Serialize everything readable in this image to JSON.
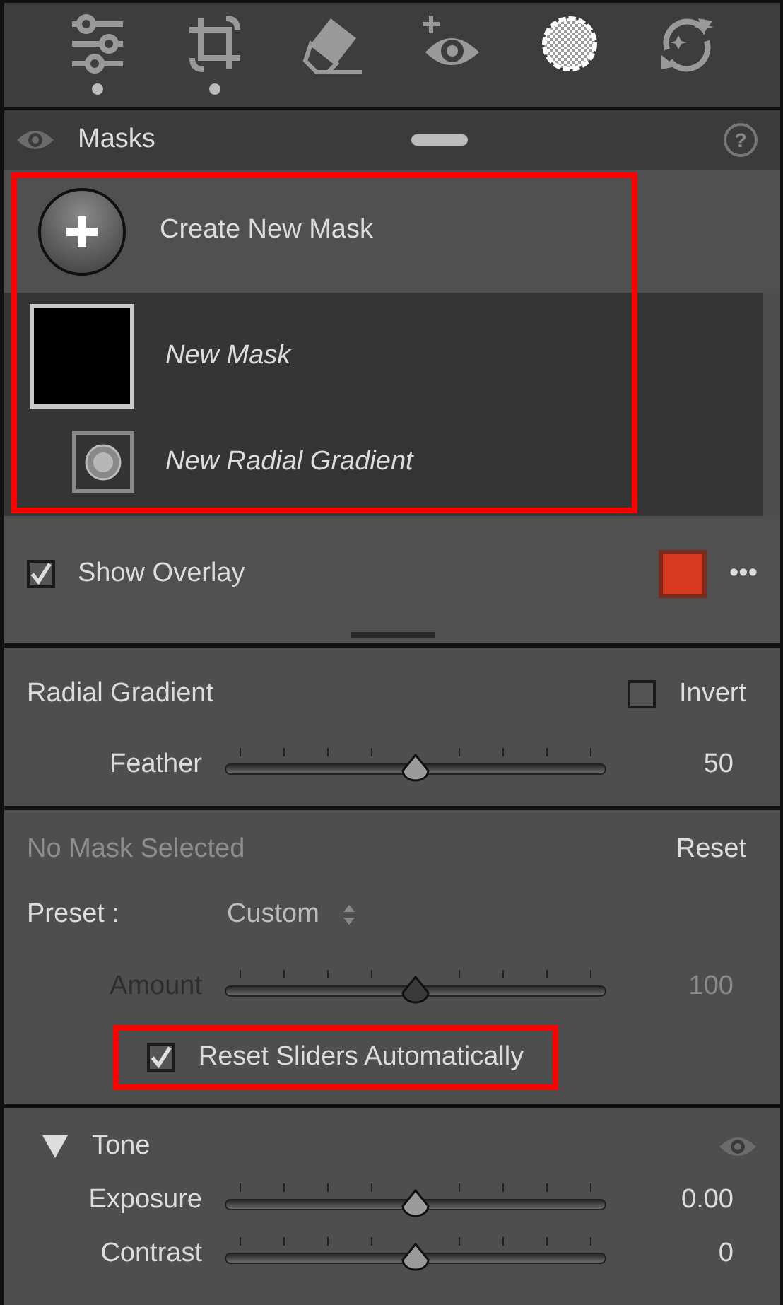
{
  "toolbar": [
    {
      "kind": "adjust",
      "selected": false,
      "modified": true
    },
    {
      "kind": "crop",
      "selected": false,
      "modified": true
    },
    {
      "kind": "heal",
      "selected": false,
      "modified": false
    },
    {
      "kind": "redeye",
      "selected": false,
      "modified": false
    },
    {
      "kind": "mask",
      "selected": true,
      "modified": false
    },
    {
      "kind": "presets",
      "selected": false,
      "modified": false
    }
  ],
  "masks_panel": {
    "title": "Masks",
    "help": "?",
    "highlighted": true,
    "create_label": "Create New Mask",
    "masks": [
      {
        "name": "New Mask",
        "kind": "mask",
        "children": [
          {
            "name": "New Radial Gradient",
            "kind": "radial"
          }
        ]
      }
    ]
  },
  "overlay": {
    "label": "Show Overlay",
    "checked": true,
    "color": "#d63a1e",
    "more": "•••"
  },
  "tool_section": {
    "title": "Radial Gradient",
    "invert": {
      "label": "Invert",
      "checked": false
    },
    "sliders": [
      {
        "label": "Feather",
        "level": 0.5,
        "value": "50",
        "disabled": false
      }
    ]
  },
  "mask_section": {
    "title": "No Mask Selected",
    "reset": "Reset",
    "preset_label": "Preset :",
    "preset_value": "Custom",
    "sliders": [
      {
        "label": "Amount",
        "level": 0.5,
        "value": "100",
        "disabled": true
      }
    ],
    "reset_sliders": {
      "label": "Reset Sliders Automatically",
      "checked": true,
      "highlighted": true
    }
  },
  "tone_section": {
    "title": "Tone",
    "expanded": true,
    "sliders": [
      {
        "label": "Exposure",
        "level": 0.5,
        "value": "0.00",
        "disabled": false
      },
      {
        "label": "Contrast",
        "level": 0.5,
        "value": "0",
        "disabled": false
      }
    ]
  }
}
